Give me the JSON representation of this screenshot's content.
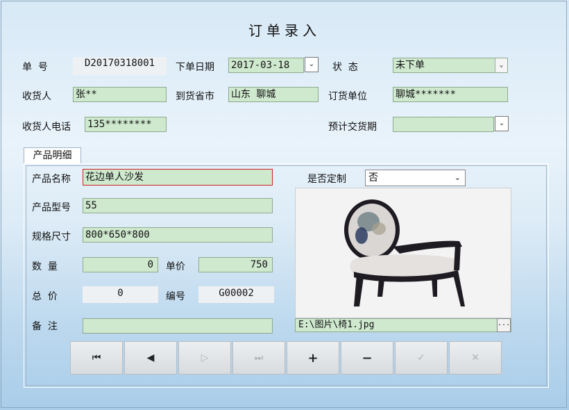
{
  "title": "订单录入",
  "order": {
    "no_label": "单  号",
    "no_value": "D20170318001",
    "date_label": "下单日期",
    "date_value": "2017-03-18",
    "status_label": "状  态",
    "status_value": "未下单",
    "receiver_label": "收货人",
    "receiver_value": "张**",
    "province_label": "到货省市",
    "province_value": "山东 聊城",
    "unit_label": "订货单位",
    "unit_value": "聊城*******",
    "phone_label": "收货人电话",
    "phone_value": "135********",
    "delivery_label": "预计交货期",
    "delivery_value": ""
  },
  "tab": {
    "label": "产品明细"
  },
  "product": {
    "name_label": "产品名称",
    "name_value": "花边单人沙发",
    "custom_label": "是否定制",
    "custom_value": "否",
    "model_label": "产品型号",
    "model_value": "55",
    "size_label": "规格尺寸",
    "size_value": "800*650*800",
    "qty_label": "数  量",
    "qty_value": "0",
    "price_label": "单价",
    "price_value": "750",
    "total_label": "总  价",
    "total_value": "0",
    "code_label": "编号",
    "code_value": "G00002",
    "remark_label": "备  注",
    "remark_value": "",
    "image_path": "E:\\图片\\椅1.jpg"
  },
  "nav": {
    "first": "⏮",
    "prev": "◀",
    "next": "▷",
    "last": "⏭",
    "add": "+",
    "remove": "−",
    "confirm": "✓",
    "cancel": "✕"
  },
  "icons": [
    "chevron-down-icon",
    "ellipsis-icon",
    "chair-image"
  ]
}
